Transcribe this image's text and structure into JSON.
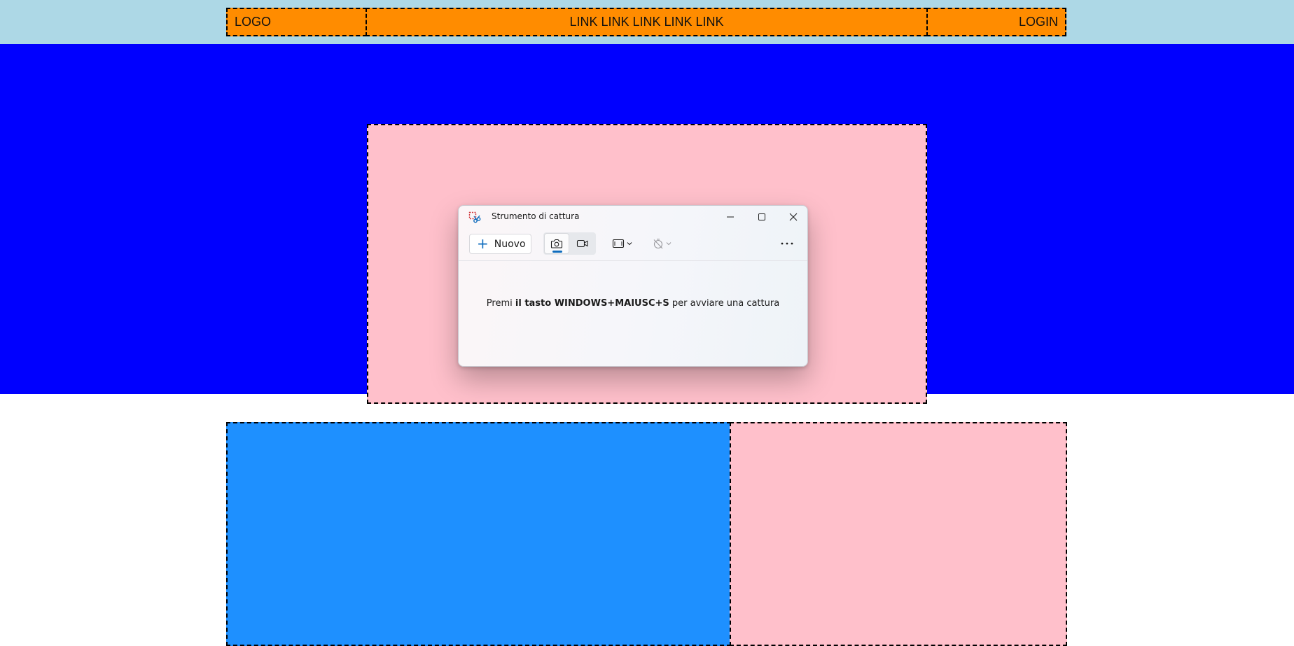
{
  "page": {
    "header": {
      "logo_label": "LOGO",
      "links_label": "LINK LINK LINK LINK LINK",
      "login_label": "LOGIN"
    }
  },
  "colors": {
    "header_bg": "#add8e6",
    "header_box": "#ff8c00",
    "hero_bg": "#0000ff",
    "pink_box": "#ffc0cb",
    "blue_box": "#1e90ff"
  },
  "snipping_tool": {
    "title": "Strumento di cattura",
    "new_button_label": "Nuovo",
    "hint": {
      "prefix": "Premi ",
      "bold": "il tasto WINDOWS+MAIUSC+S",
      "suffix": " per avviare una cattura"
    },
    "icons": [
      "snipping-tool-icon",
      "minimize-icon",
      "maximize-icon",
      "close-icon",
      "plus-icon",
      "camera-icon",
      "video-camera-icon",
      "rectangle-mode-icon",
      "chevron-down-icon",
      "timer-off-icon",
      "more-options-icon"
    ]
  }
}
